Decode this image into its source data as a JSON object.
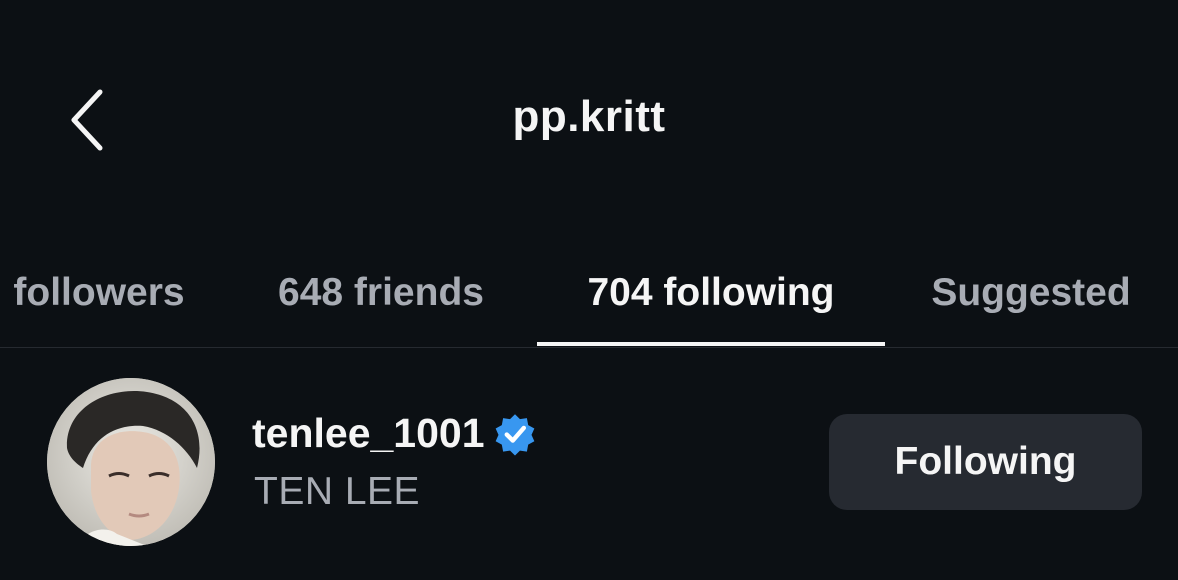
{
  "header": {
    "title": "pp.kritt",
    "back_icon": "chevron-left-icon"
  },
  "tabs": [
    {
      "label": "followers",
      "active": false
    },
    {
      "label": "648 friends",
      "active": false
    },
    {
      "label": "704 following",
      "active": true
    },
    {
      "label": "Suggested",
      "active": false
    }
  ],
  "list": [
    {
      "username": "tenlee_1001",
      "verified": true,
      "full_name": "TEN LEE",
      "button_label": "Following"
    }
  ],
  "colors": {
    "background": "#0c1014",
    "text_primary": "#f5f5f5",
    "text_secondary": "#a8acb4",
    "verified_badge": "#3897f0",
    "button_bg": "#262a31"
  }
}
